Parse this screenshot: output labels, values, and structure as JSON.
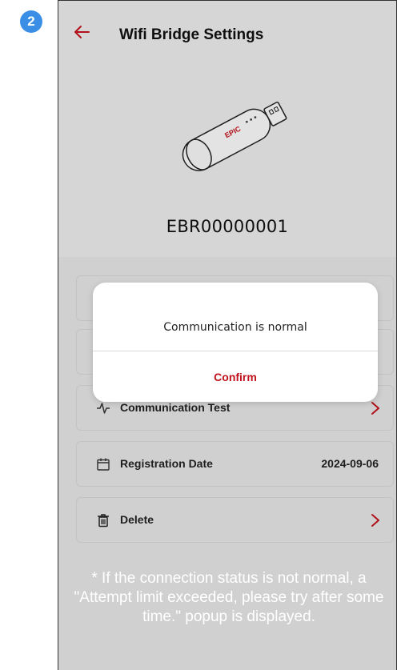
{
  "step_badge": "2",
  "header": {
    "title": "Wifi Bridge Settings"
  },
  "device": {
    "id": "EBR00000001",
    "brand_text": "EPIC"
  },
  "list": {
    "communication_test": {
      "label": "Communication Test"
    },
    "registration_date": {
      "label": "Registration Date",
      "value": "2024-09-06"
    },
    "delete": {
      "label": "Delete"
    }
  },
  "dialog": {
    "message": "Communication is normal",
    "confirm_label": "Confirm"
  },
  "footnote": "* If the connection status is not normal, a \"Attempt limit exceeded, please try after some time.\" popup is displayed.",
  "colors": {
    "accent": "#c0121c",
    "badge": "#3a8ee6"
  }
}
